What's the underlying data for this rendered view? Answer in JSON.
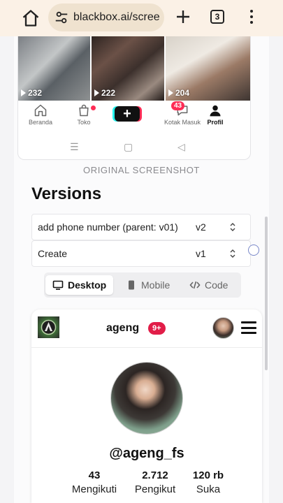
{
  "browser": {
    "url": "blackbox.ai/scree",
    "tab_count": "3"
  },
  "screenshot": {
    "thumbs": [
      {
        "count": "232"
      },
      {
        "count": "222"
      },
      {
        "count": "204"
      }
    ],
    "nav": {
      "home": "Beranda",
      "shop": "Toko",
      "inbox": "Kotak Masuk",
      "inbox_badge": "43",
      "profile": "Profil"
    },
    "label": "ORIGINAL SCREENSHOT"
  },
  "versions": {
    "title": "Versions",
    "rows": [
      {
        "name": "add phone number (parent: v01)",
        "version": "v2"
      },
      {
        "name": "Create",
        "version": "v1"
      }
    ]
  },
  "view_tabs": {
    "desktop": "Desktop",
    "mobile": "Mobile",
    "code": "Code",
    "active": "Desktop"
  },
  "preview": {
    "username": "ageng",
    "notif_badge": "9+",
    "handle": "@ageng_fs",
    "stats": [
      {
        "value": "43",
        "label": "Mengikuti"
      },
      {
        "value": "2.712",
        "label": "Pengikut"
      },
      {
        "value": "120 rb",
        "label": "Suka"
      }
    ]
  },
  "colors": {
    "browser_bar": "#fbf1e6",
    "badge_red": "#e11d48",
    "tiktok_pink": "#fe2c55"
  }
}
